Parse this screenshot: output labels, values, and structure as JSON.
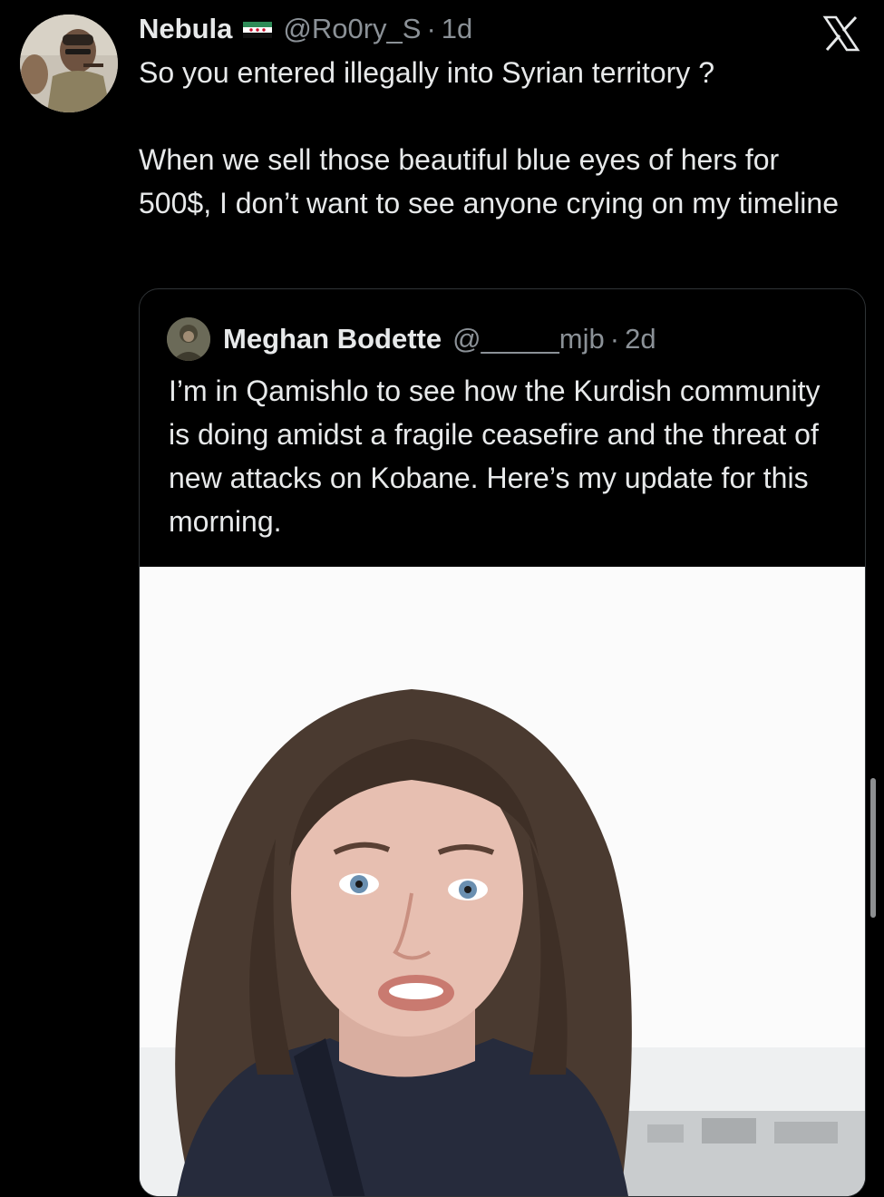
{
  "tweet": {
    "display_name": "Nebula",
    "flag_icon": "syria-revolution-flag-icon",
    "handle": "@Ro0ry_S",
    "separator": "·",
    "time": "1d",
    "paragraphs": [
      "So you entered illegally into Syrian territory ?",
      "When we sell those beautiful blue eyes of hers for 500$, I don’t want to see anyone crying on my timeline"
    ]
  },
  "quote": {
    "display_name": "Meghan Bodette",
    "handle": "@_____mjb",
    "separator": "·",
    "time": "2d",
    "text": "I’m in Qamishlo to see how the Kurdish community is doing amidst a fragile ceasefire and the threat of new attacks on Kobane. Here’s my update for this morning."
  },
  "icons": {
    "close": "x-logo-icon"
  },
  "colors": {
    "background": "#000000",
    "primary_text": "#e7e9ea",
    "secondary_text": "#8b9197",
    "border": "#2f3336"
  }
}
